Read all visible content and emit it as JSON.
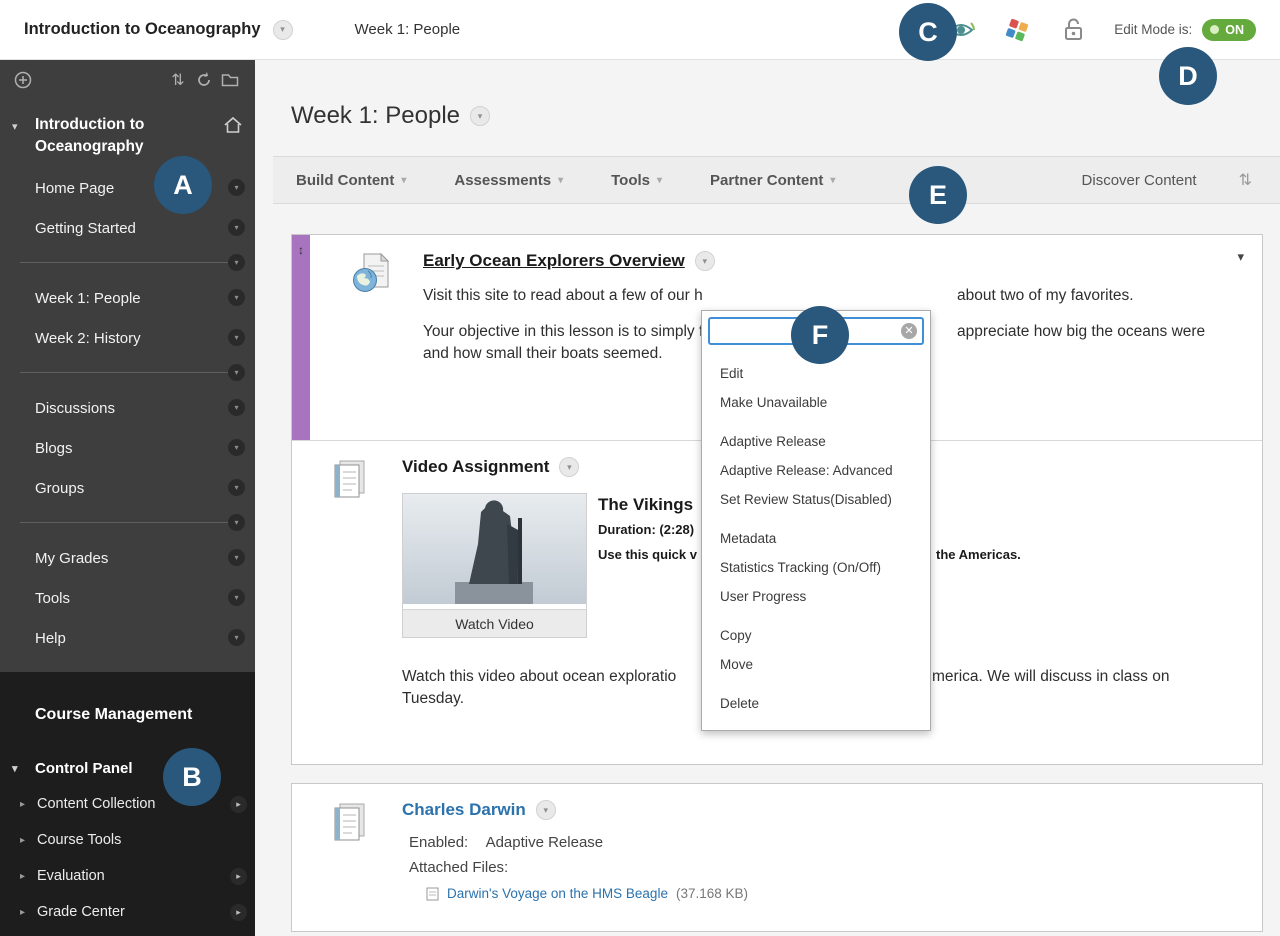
{
  "topbar": {
    "course_title": "Introduction to Oceanography",
    "breadcrumb": "Week 1: People",
    "edit_mode_label": "Edit Mode is:",
    "edit_mode_value": "ON"
  },
  "sidebar": {
    "course_title": "Introduction to Oceanography",
    "nav_items": [
      "Home Page",
      "Getting Started",
      "Week 1: People",
      "Week 2: History",
      "Discussions",
      "Blogs",
      "Groups",
      "My Grades",
      "Tools",
      "Help"
    ],
    "course_management_title": "Course Management",
    "control_panel_label": "Control Panel",
    "control_panel_items": [
      "Content Collection",
      "Course Tools",
      "Evaluation",
      "Grade Center"
    ]
  },
  "main": {
    "page_title": "Week 1: People",
    "action_buttons": [
      "Build Content",
      "Assessments",
      "Tools",
      "Partner Content"
    ],
    "discover_label": "Discover Content",
    "item1": {
      "title": "Early Ocean Explorers Overview",
      "p1_left": "Visit this site to read about a few of our h",
      "p1_right": "about two of my favorites.",
      "p2_left": "Your objective in this lesson is to simply f",
      "p2_right": "appreciate how big the oceans were",
      "p2_line2": "and how small their boats seemed."
    },
    "item2": {
      "title": "Video Assignment",
      "video_title": "The Vikings",
      "duration": "Duration: (2:28)",
      "caption_left": "Use this quick v",
      "caption_right": "the Americas.",
      "watch_button": "Watch Video",
      "p_left": "Watch this video about ocean exploratio",
      "p_right": "merica. We will discuss in class on",
      "p_line2": "Tuesday."
    },
    "item3": {
      "title": "Charles Darwin",
      "enabled_label": "Enabled:",
      "enabled_value": "Adaptive Release",
      "attached_label": "Attached Files:",
      "file_name": "Darwin's Voyage on the HMS Beagle",
      "file_size": "(37.168 KB)"
    }
  },
  "context_menu": {
    "groups": [
      [
        "Edit",
        "Make Unavailable"
      ],
      [
        "Adaptive Release",
        "Adaptive Release: Advanced",
        "Set Review Status(Disabled)"
      ],
      [
        "Metadata",
        "Statistics Tracking (On/Off)",
        "User Progress"
      ],
      [
        "Copy",
        "Move"
      ],
      [
        "Delete"
      ]
    ]
  },
  "annotations": {
    "A": "A",
    "B": "B",
    "C": "C",
    "D": "D",
    "E": "E",
    "F": "F"
  }
}
